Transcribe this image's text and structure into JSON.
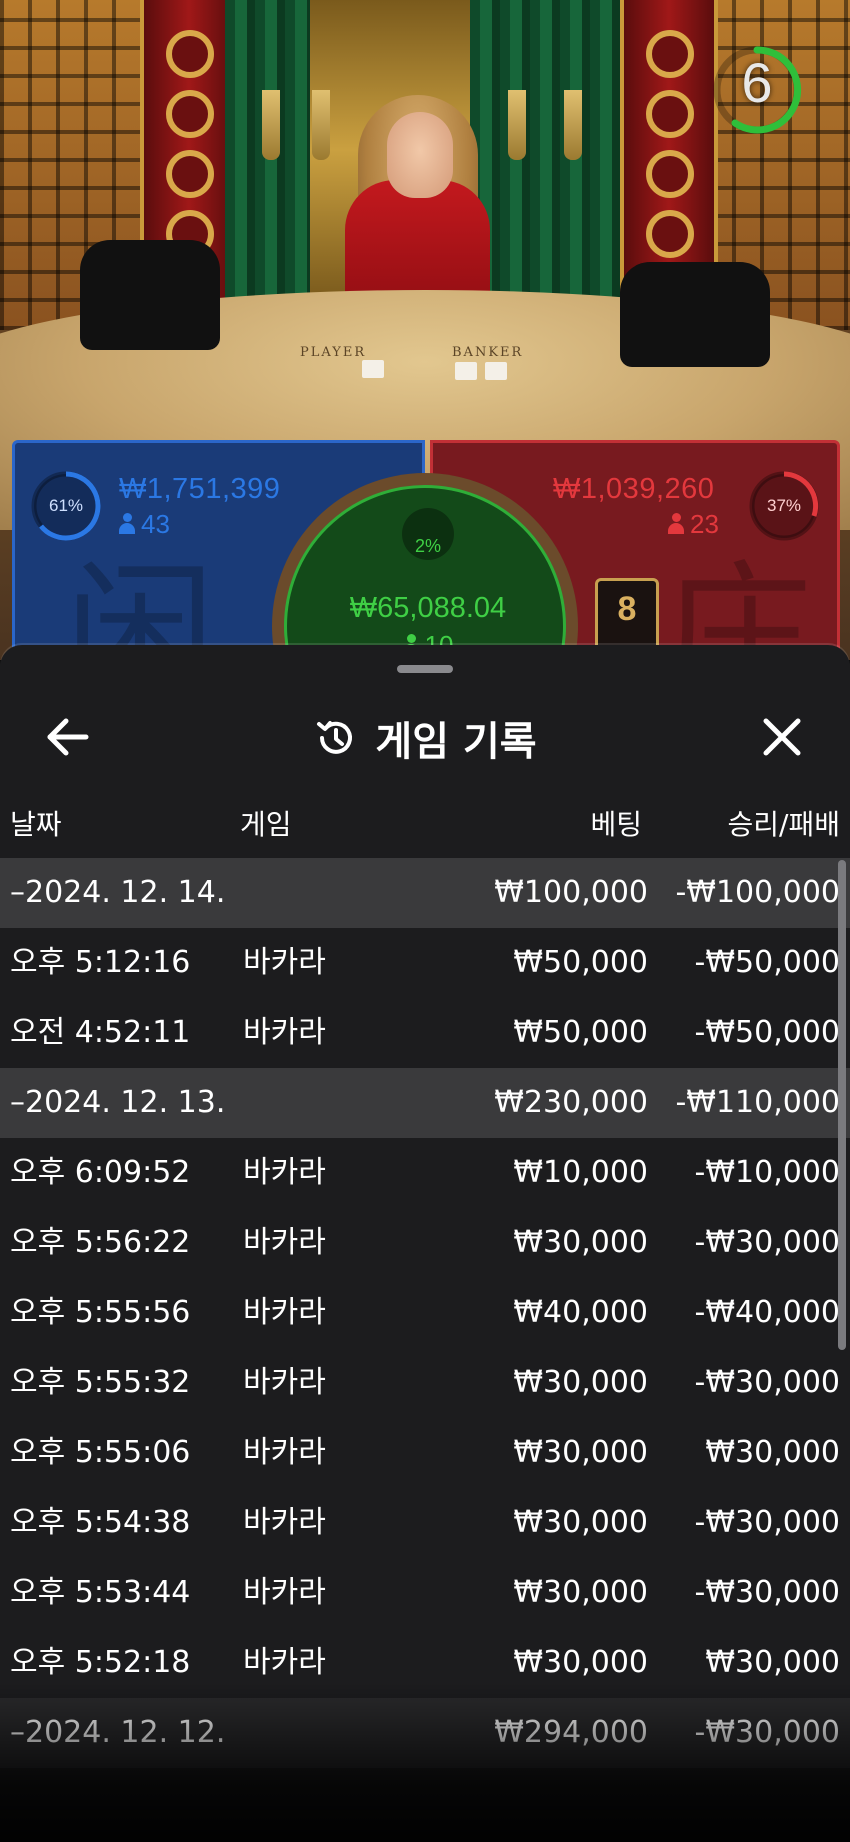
{
  "timer": {
    "value": "6",
    "color": "#2fbf3a"
  },
  "table_labels": {
    "player": "PLAYER",
    "banker": "BANKER"
  },
  "player_panel": {
    "percent": "61%",
    "percent_value": 0.61,
    "amount": "₩1,751,399",
    "count": "43",
    "color": "#2b66c9",
    "glyph": "闲"
  },
  "banker_panel": {
    "percent": "37%",
    "percent_value": 0.37,
    "amount": "₩1,039,260",
    "count": "23",
    "color": "#d63a3a",
    "glyph": "庄"
  },
  "tie_panel": {
    "percent": "2%",
    "percent_value": 0.02,
    "amount": "₩65,088.04",
    "count": "10",
    "color": "#3fcf45"
  },
  "side_badge": "8",
  "sheet": {
    "title": "게임 기록",
    "title_icon": "history-icon",
    "back_icon": "arrow-left-icon",
    "close_icon": "close-icon",
    "columns": {
      "date": "날짜",
      "game": "게임",
      "bet": "베팅",
      "win_loss": "승리/패배"
    },
    "groups": [
      {
        "date": "–2024. 12. 14.",
        "bet": "₩100,000",
        "result": "-₩100,000",
        "items": [
          {
            "time": "오후 5:12:16",
            "game": "바카라",
            "bet": "₩50,000",
            "result": "-₩50,000"
          },
          {
            "time": "오전 4:52:11",
            "game": "바카라",
            "bet": "₩50,000",
            "result": "-₩50,000"
          }
        ]
      },
      {
        "date": "–2024. 12. 13.",
        "bet": "₩230,000",
        "result": "-₩110,000",
        "items": [
          {
            "time": "오후 6:09:52",
            "game": "바카라",
            "bet": "₩10,000",
            "result": "-₩10,000"
          },
          {
            "time": "오후 5:56:22",
            "game": "바카라",
            "bet": "₩30,000",
            "result": "-₩30,000"
          },
          {
            "time": "오후 5:55:56",
            "game": "바카라",
            "bet": "₩40,000",
            "result": "-₩40,000"
          },
          {
            "time": "오후 5:55:32",
            "game": "바카라",
            "bet": "₩30,000",
            "result": "-₩30,000"
          },
          {
            "time": "오후 5:55:06",
            "game": "바카라",
            "bet": "₩30,000",
            "result": "₩30,000"
          },
          {
            "time": "오후 5:54:38",
            "game": "바카라",
            "bet": "₩30,000",
            "result": "-₩30,000"
          },
          {
            "time": "오후 5:53:44",
            "game": "바카라",
            "bet": "₩30,000",
            "result": "-₩30,000"
          },
          {
            "time": "오후 5:52:18",
            "game": "바카라",
            "bet": "₩30,000",
            "result": "₩30,000"
          }
        ]
      },
      {
        "date": "–2024. 12. 12.",
        "bet": "₩294,000",
        "result": "-₩30,000",
        "items": []
      }
    ]
  }
}
